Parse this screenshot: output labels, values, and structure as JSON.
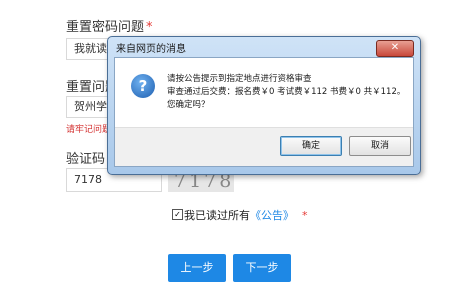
{
  "form": {
    "reset_question_label": "重置密码问题",
    "reset_question_value": "我就读的",
    "reset_answer_label": "重置问题",
    "reset_answer_value": "贺州学院",
    "error_text": "请牢记问题",
    "captcha_label": "验证码",
    "captcha_value": "7178",
    "captcha_image_text": "7178",
    "required_mark": "*",
    "agree_prefix": "我已读过所有",
    "agree_link": "《公告》",
    "check_glyph": "✓",
    "prev_button": "上一步",
    "next_button": "下一步"
  },
  "dialog": {
    "title": "来自网页的消息",
    "close_glyph": "✕",
    "icon_glyph": "?",
    "line1": "请按公告提示到指定地点进行资格审查",
    "line2": "审查通过后交费：报名费￥0 考试费￥112 书费￥0 共￥112。",
    "line3": "您确定吗？",
    "ok_button": "确定",
    "cancel_button": "取消"
  },
  "colors": {
    "accent": "#1e88e5",
    "required": "#e53935",
    "link": "#1e88e5"
  }
}
